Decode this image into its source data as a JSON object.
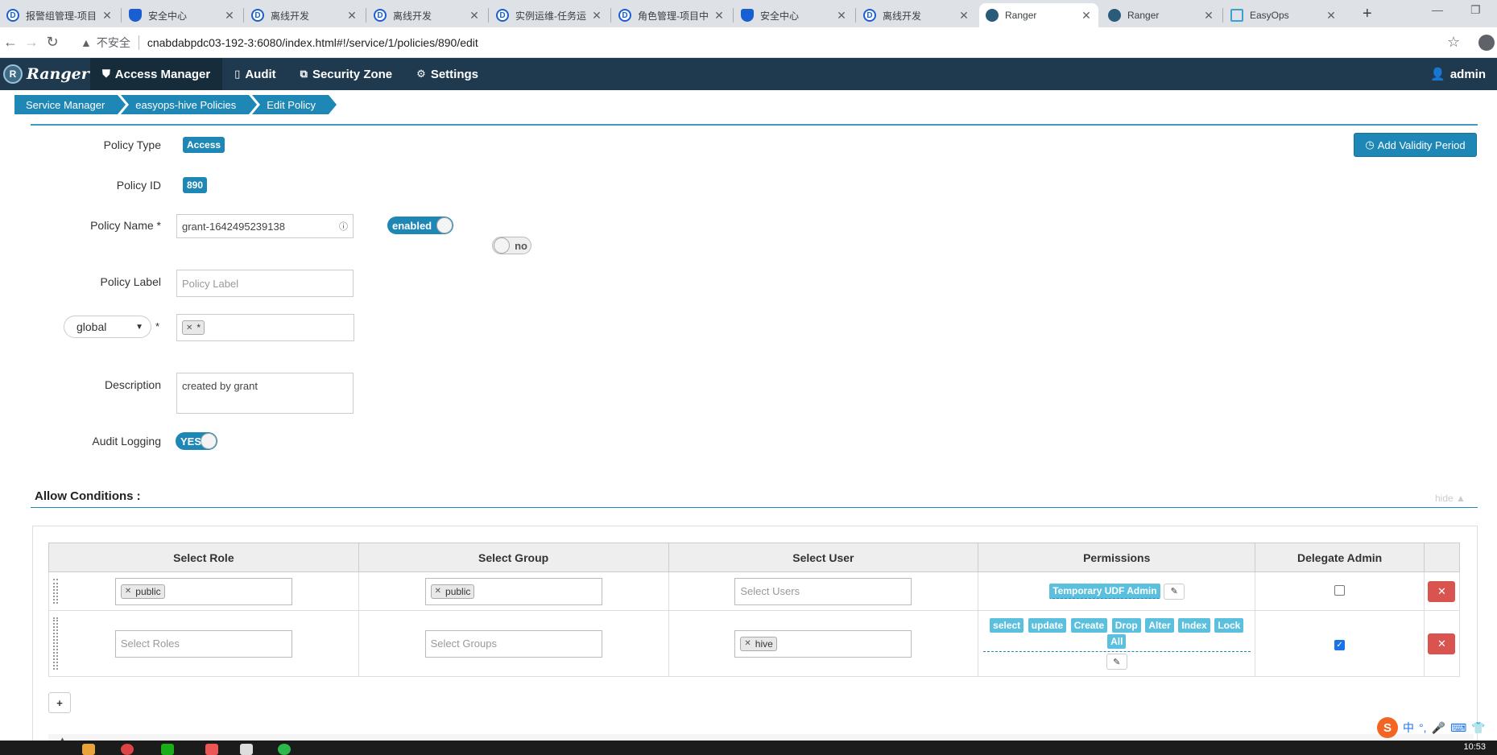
{
  "browser": {
    "tabs": [
      {
        "label": "报警组管理-项目",
        "icon": "d"
      },
      {
        "label": "安全中心",
        "icon": "s"
      },
      {
        "label": "离线开发",
        "icon": "d"
      },
      {
        "label": "离线开发",
        "icon": "d"
      },
      {
        "label": "实例运维-任务运",
        "icon": "d"
      },
      {
        "label": "角色管理-项目中",
        "icon": "d"
      },
      {
        "label": "安全中心",
        "icon": "s"
      },
      {
        "label": "离线开发",
        "icon": "d"
      },
      {
        "label": "Ranger",
        "icon": "r"
      },
      {
        "label": "Ranger",
        "icon": "r"
      },
      {
        "label": "EasyOps",
        "icon": "e"
      }
    ],
    "insecure_label": "不安全",
    "url": "cnabdabpdc03-192-3:6080/index.html#!/service/1/policies/890/edit"
  },
  "header": {
    "brand": "Ranger",
    "menu": [
      "Access Manager",
      "Audit",
      "Security Zone",
      "Settings"
    ],
    "user": "admin"
  },
  "breadcrumb": [
    "Service Manager",
    "easyops-hive Policies",
    "Edit Policy"
  ],
  "form": {
    "policy_type_label": "Policy Type",
    "policy_type_value": "Access",
    "policy_id_label": "Policy ID",
    "policy_id_value": "890",
    "policy_name_label": "Policy Name *",
    "policy_name_value": "grant-1642495239138",
    "enabled_toggle": "enabled",
    "normal_toggle": "no",
    "policy_label_label": "Policy Label",
    "policy_label_placeholder": "Policy Label",
    "resource_select": "global",
    "resource_required": "*",
    "resource_tag": "*",
    "description_label": "Description",
    "description_value": "created by grant",
    "audit_logging_label": "Audit Logging",
    "audit_logging_value": "YES",
    "add_validity_button": "Add Validity Period"
  },
  "allow_conditions": {
    "title": "Allow Conditions :",
    "hide_link": "hide",
    "columns": [
      "Select Role",
      "Select Group",
      "Select User",
      "Permissions",
      "Delegate Admin"
    ],
    "rows": [
      {
        "role_tag": "public",
        "group_tag": "public",
        "user_placeholder": "Select Users",
        "permissions": [
          "Temporary UDF Admin"
        ],
        "delegate_admin": false
      },
      {
        "role_placeholder": "Select Roles",
        "group_placeholder": "Select Groups",
        "user_tag": "hive",
        "permissions": [
          "select",
          "update",
          "Create",
          "Drop",
          "Alter",
          "Index",
          "Lock",
          "All"
        ],
        "delegate_admin": true
      }
    ]
  },
  "taskbar": {
    "clock": "10:53"
  },
  "ime": {
    "mode": "中"
  }
}
